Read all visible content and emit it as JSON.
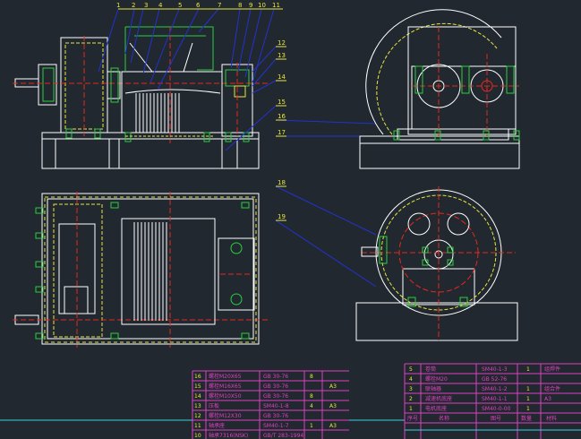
{
  "callouts_top": [
    "1",
    "2",
    "3",
    "4",
    "5",
    "6",
    "7",
    "8",
    "9",
    "10",
    "11"
  ],
  "callouts_side": [
    "12",
    "13",
    "14",
    "15",
    "16",
    "17",
    "18",
    "19"
  ],
  "bom_left": {
    "rows": [
      {
        "no": "16",
        "name": "螺栓M20X65",
        "code": "GB 30-76",
        "qty": "8",
        "mat": ""
      },
      {
        "no": "15",
        "name": "螺栓M16X65",
        "code": "GB 30-76",
        "qty": "",
        "mat": "A3"
      },
      {
        "no": "14",
        "name": "螺栓M10X50",
        "code": "GB 30-76",
        "qty": "8",
        "mat": ""
      },
      {
        "no": "13",
        "name": "压板",
        "code": "SM40-1-8",
        "qty": "4",
        "mat": "A3"
      },
      {
        "no": "12",
        "name": "螺栓M12X30",
        "code": "GB 30-76",
        "qty": "",
        "mat": ""
      },
      {
        "no": "11",
        "name": "轴承座",
        "code": "SM40-1-7",
        "qty": "1",
        "mat": "A3"
      },
      {
        "no": "10",
        "name": "轴承7316(NSK)",
        "code": "GB/T 283-1994",
        "qty": "",
        "mat": ""
      }
    ]
  },
  "bom_right": {
    "rows": [
      {
        "no": "5",
        "name": "卷筒",
        "code": "SM40-1-3",
        "qty": "1",
        "mat": "组焊件"
      },
      {
        "no": "4",
        "name": "螺栓M20",
        "code": "GB 52-76",
        "qty": "",
        "mat": ""
      },
      {
        "no": "3",
        "name": "联轴器",
        "code": "SM40-1-2",
        "qty": "1",
        "mat": "组合件"
      },
      {
        "no": "2",
        "name": "减速机底座",
        "code": "SM40-1-1",
        "qty": "1",
        "mat": "A3"
      },
      {
        "no": "1",
        "name": "电机底座",
        "code": "SM40-0-00",
        "qty": "1",
        "mat": ""
      }
    ],
    "header": {
      "no": "序号",
      "name": "名称",
      "code": "图号",
      "qty": "数量",
      "mat": "材料"
    }
  },
  "colors": {
    "background": "#212830",
    "line_white": "#ffffff",
    "line_green": "#29d13c",
    "line_yellow": "#e9e640",
    "line_red": "#e8291c",
    "line_blue": "#2233cc",
    "line_cyan": "#3ad0e0",
    "text_magenta": "#e040c0",
    "text_yellow": "#e0d040"
  }
}
